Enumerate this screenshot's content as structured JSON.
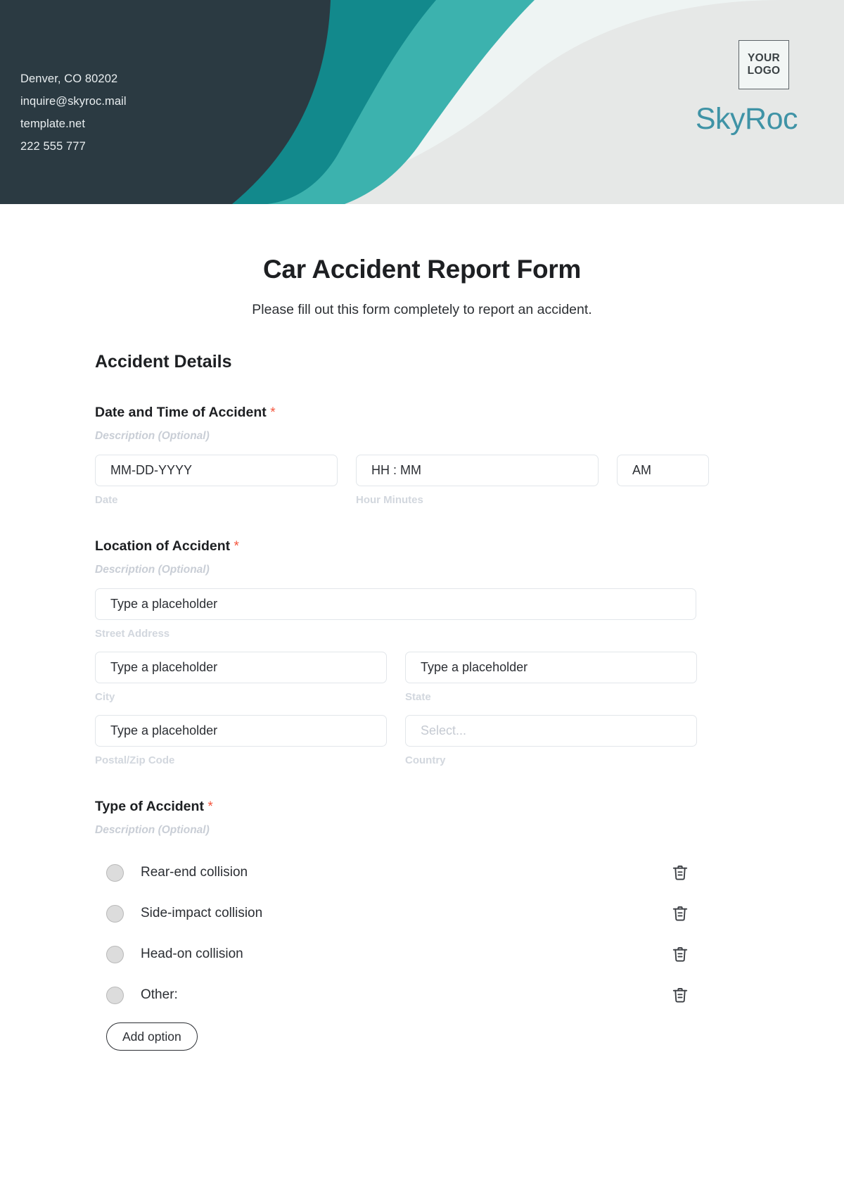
{
  "header": {
    "contact": [
      "Denver, CO 80202",
      "inquire@skyroc.mail",
      "template.net",
      "222 555 777"
    ],
    "logo_line1": "YOUR",
    "logo_line2": "LOGO",
    "brand": "SkyRoc",
    "colors": {
      "dark": "#2b3a42",
      "teal_dark": "#12898c",
      "teal_light": "#3cb2ae",
      "panel": "#eef4f3",
      "gray_wave": "#e6e8e7",
      "brand_text": "#3f93a6"
    }
  },
  "form": {
    "title": "Car Accident Report Form",
    "subtitle": "Please fill out this form completely to report an accident.",
    "section_title": "Accident Details",
    "required_marker": "*",
    "description_placeholder": "Description (Optional)",
    "fields": {
      "datetime": {
        "label": "Date and Time of Accident",
        "description": "Description (Optional)",
        "date_placeholder": "MM-DD-YYYY",
        "time_placeholder": "HH : MM",
        "ampm_value": "AM",
        "date_sub_label": "Date",
        "time_sub_label": "Hour Minutes"
      },
      "location": {
        "label": "Location of Accident",
        "description": "Description (Optional)",
        "street_placeholder": "Type a placeholder",
        "street_sub_label": "Street Address",
        "city_placeholder": "Type a placeholder",
        "city_sub_label": "City",
        "state_placeholder": "Type a placeholder",
        "state_sub_label": "State",
        "postal_placeholder": "Type a placeholder",
        "postal_sub_label": "Postal/Zip Code",
        "country_placeholder": "Select...",
        "country_sub_label": "Country"
      },
      "accident_type": {
        "label": "Type of Accident",
        "description": "Description (Optional)",
        "options": [
          "Rear-end collision",
          "Side-impact collision",
          "Head-on collision",
          "Other:"
        ],
        "add_option_label": "Add option",
        "delete_icon": "trash-icon"
      }
    }
  }
}
